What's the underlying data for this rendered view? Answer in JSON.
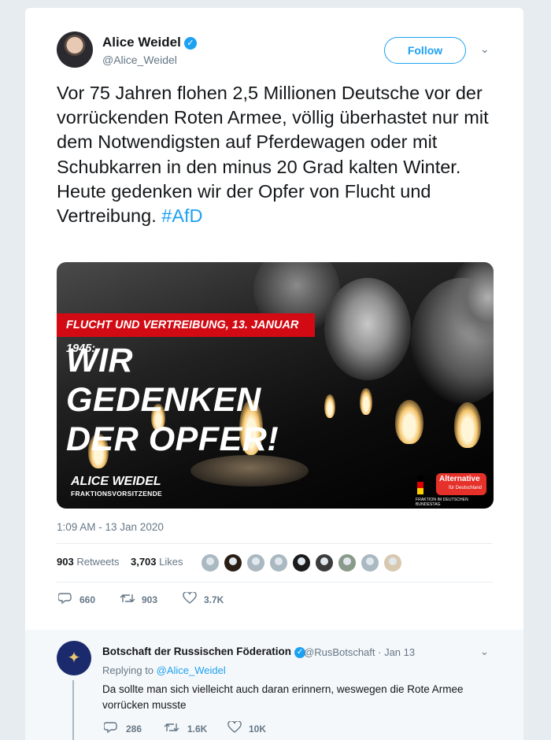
{
  "author": {
    "name": "Alice Weidel",
    "handle": "@Alice_Weidel",
    "verified_glyph": "✓",
    "follow_label": "Follow",
    "menu_glyph": "⌄"
  },
  "tweet": {
    "text": "Vor 75 Jahren flohen 2,5 Millionen Deutsche vor der vorrückenden Roten Armee, völlig überhastet nur mit dem Notwendigsten auf Pferdewagen oder mit Schubkarren in den minus 20 Grad kalten Winter. Heute gedenken wir der Opfer von Flucht und Vertreibung. ",
    "hashtag": "#AfD",
    "timestamp": "1:09 AM - 13 Jan 2020"
  },
  "media": {
    "banner": "FLUCHT UND VERTREIBUNG, 13. JANUAR 1945:",
    "headline_line1": "WIR GEDENKEN",
    "headline_line2": "DER OPFER!",
    "name": "ALICE WEIDEL",
    "role": "FRAKTIONSVORSITZENDE",
    "logo_word": "Alternative",
    "logo_sub": "für Deutschland",
    "logo_fraktion": "FRAKTION IM DEUTSCHEN BUNDESTAG"
  },
  "stats": {
    "retweets_count": "903",
    "retweets_label": "Retweets",
    "likes_count": "3,703",
    "likes_label": "Likes"
  },
  "actions": {
    "reply_count": "660",
    "retweet_count": "903",
    "like_count": "3.7K",
    "reply_icon": "reply-icon",
    "retweet_icon": "retweet-icon",
    "like_icon": "heart-icon"
  },
  "reply": {
    "name": "Botschaft der Russischen Föderation",
    "handle_date": "@RusBotschaft · Jan 13",
    "replying_prefix": "Replying to ",
    "replying_to": "@Alice_Weidel",
    "text": "Da sollte man sich vielleicht auch daran erinnern, weswegen die Rote Armee vorrücken musste",
    "reply_count": "286",
    "retweet_count": "1.6K",
    "like_count": "10K"
  },
  "colors": {
    "accent": "#1da1f2",
    "banner_red": "#d20a14",
    "afd_red": "#e5312a",
    "text_secondary": "#657786"
  }
}
